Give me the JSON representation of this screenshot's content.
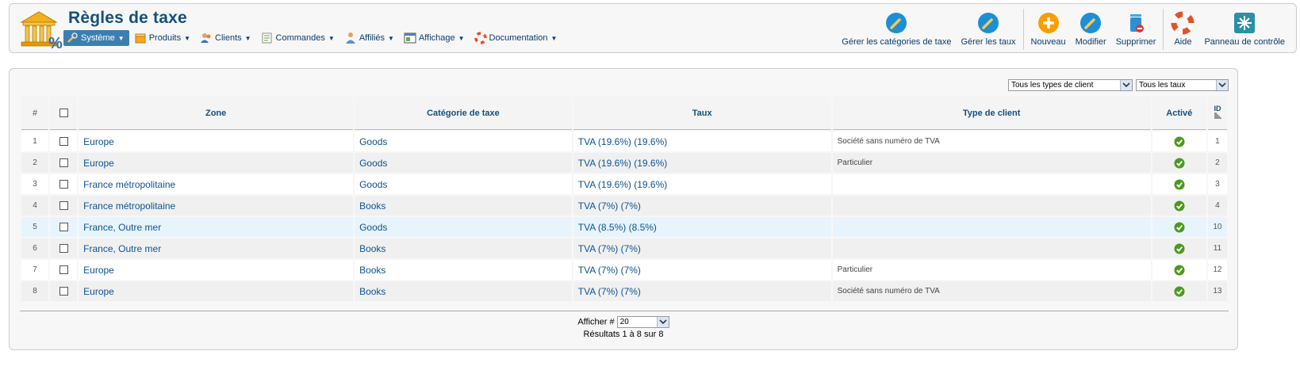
{
  "page": {
    "title": "Règles de taxe"
  },
  "menu": [
    {
      "label": "Système",
      "icon": "tools-icon",
      "active": true
    },
    {
      "label": "Produits",
      "icon": "box-icon"
    },
    {
      "label": "Clients",
      "icon": "users-icon"
    },
    {
      "label": "Commandes",
      "icon": "orders-icon"
    },
    {
      "label": "Affiliés",
      "icon": "affiliates-icon"
    },
    {
      "label": "Affichage",
      "icon": "display-icon"
    },
    {
      "label": "Documentation",
      "icon": "lifebuoy-icon"
    }
  ],
  "toolbar": {
    "manage_categories": "Gérer les catégories de taxe",
    "manage_rates": "Gérer les taux",
    "new": "Nouveau",
    "edit": "Modifier",
    "delete": "Supprimer",
    "help": "Aide",
    "control_panel": "Panneau de contrôle"
  },
  "filters": {
    "client_type": "Tous les types de client",
    "rate": "Tous les taux"
  },
  "table": {
    "headers": {
      "num": "#",
      "zone": "Zone",
      "category": "Catégorie de taxe",
      "rate": "Taux",
      "client_type": "Type de client",
      "active": "Activé",
      "id": "ID"
    },
    "rows": [
      {
        "n": "1",
        "zone": "Europe",
        "category": "Goods",
        "rate": "TVA (19.6%) (19.6%)",
        "client_type": "Société sans numéro de TVA",
        "id": "1"
      },
      {
        "n": "2",
        "zone": "Europe",
        "category": "Goods",
        "rate": "TVA (19.6%) (19.6%)",
        "client_type": "Particulier",
        "id": "2"
      },
      {
        "n": "3",
        "zone": "France métropolitaine",
        "category": "Goods",
        "rate": "TVA (19.6%) (19.6%)",
        "client_type": "",
        "id": "3"
      },
      {
        "n": "4",
        "zone": "France métropolitaine",
        "category": "Books",
        "rate": "TVA (7%) (7%)",
        "client_type": "",
        "id": "4"
      },
      {
        "n": "5",
        "zone": "France, Outre mer",
        "category": "Goods",
        "rate": "TVA (8.5%) (8.5%)",
        "client_type": "",
        "id": "10"
      },
      {
        "n": "6",
        "zone": "France, Outre mer",
        "category": "Books",
        "rate": "TVA (7%) (7%)",
        "client_type": "",
        "id": "11"
      },
      {
        "n": "7",
        "zone": "Europe",
        "category": "Books",
        "rate": "TVA (7%) (7%)",
        "client_type": "Particulier",
        "id": "12"
      },
      {
        "n": "8",
        "zone": "Europe",
        "category": "Books",
        "rate": "TVA (7%) (7%)",
        "client_type": "Société sans numéro de TVA",
        "id": "13"
      }
    ]
  },
  "pagination": {
    "label": "Afficher #",
    "limit": "20",
    "results": "Résultats 1 à 8 sur 8"
  },
  "colors": {
    "title": "#14507d",
    "link": "#0b5394",
    "active_menu": "#3b7fb0",
    "check": "#4a9a1e"
  }
}
